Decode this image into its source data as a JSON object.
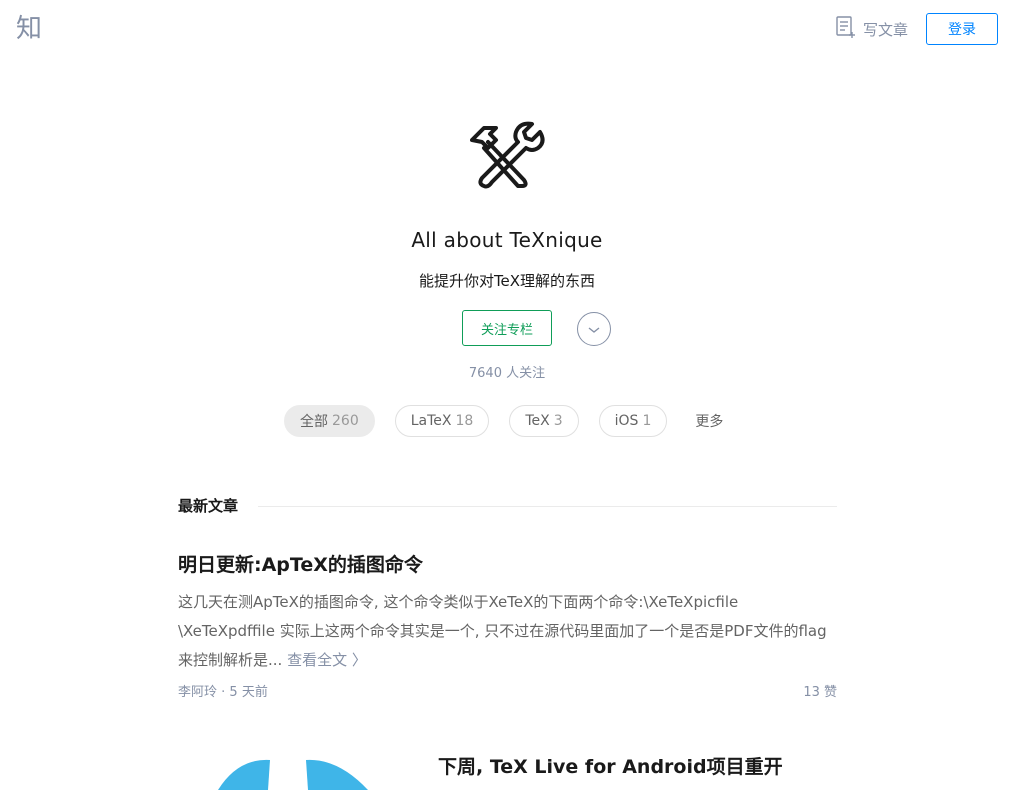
{
  "header": {
    "logo": "知",
    "write_label": "写文章",
    "login_label": "登录"
  },
  "column": {
    "icon": "tools-icon",
    "title": "All about TeXnique",
    "description": "能提升你对TeX理解的东西",
    "follow_label": "关注专栏",
    "followers": "7640 人关注"
  },
  "tags": [
    {
      "label": "全部",
      "count": "260"
    },
    {
      "label": "LaTeX",
      "count": "18"
    },
    {
      "label": "TeX",
      "count": "3"
    },
    {
      "label": "iOS",
      "count": "1"
    },
    {
      "label": "更多",
      "count": ""
    }
  ],
  "section": {
    "title": "最新文章"
  },
  "posts": [
    {
      "title": "明日更新:ApTeX的插图命令",
      "excerpt": "这几天在测ApTeX的插图命令, 这个命令类似于XeTeX的下面两个命令:\\XeTeXpicfile \\XeTeXpdffile 实际上这两个命令其实是一个, 只不过在源代码里面加了一个是否是PDF文件的flag来控制解析是...",
      "read_more": "查看全文 〉",
      "author": "李阿玲",
      "time": "5 天前",
      "likes": "13 赞"
    },
    {
      "title": "下周, TeX Live for Android项目重开"
    }
  ],
  "colors": {
    "accent": "#0084ff",
    "follow_green": "#0f9d58",
    "muted": "#8590a6",
    "thumb_blue": "#3fb5e8"
  }
}
